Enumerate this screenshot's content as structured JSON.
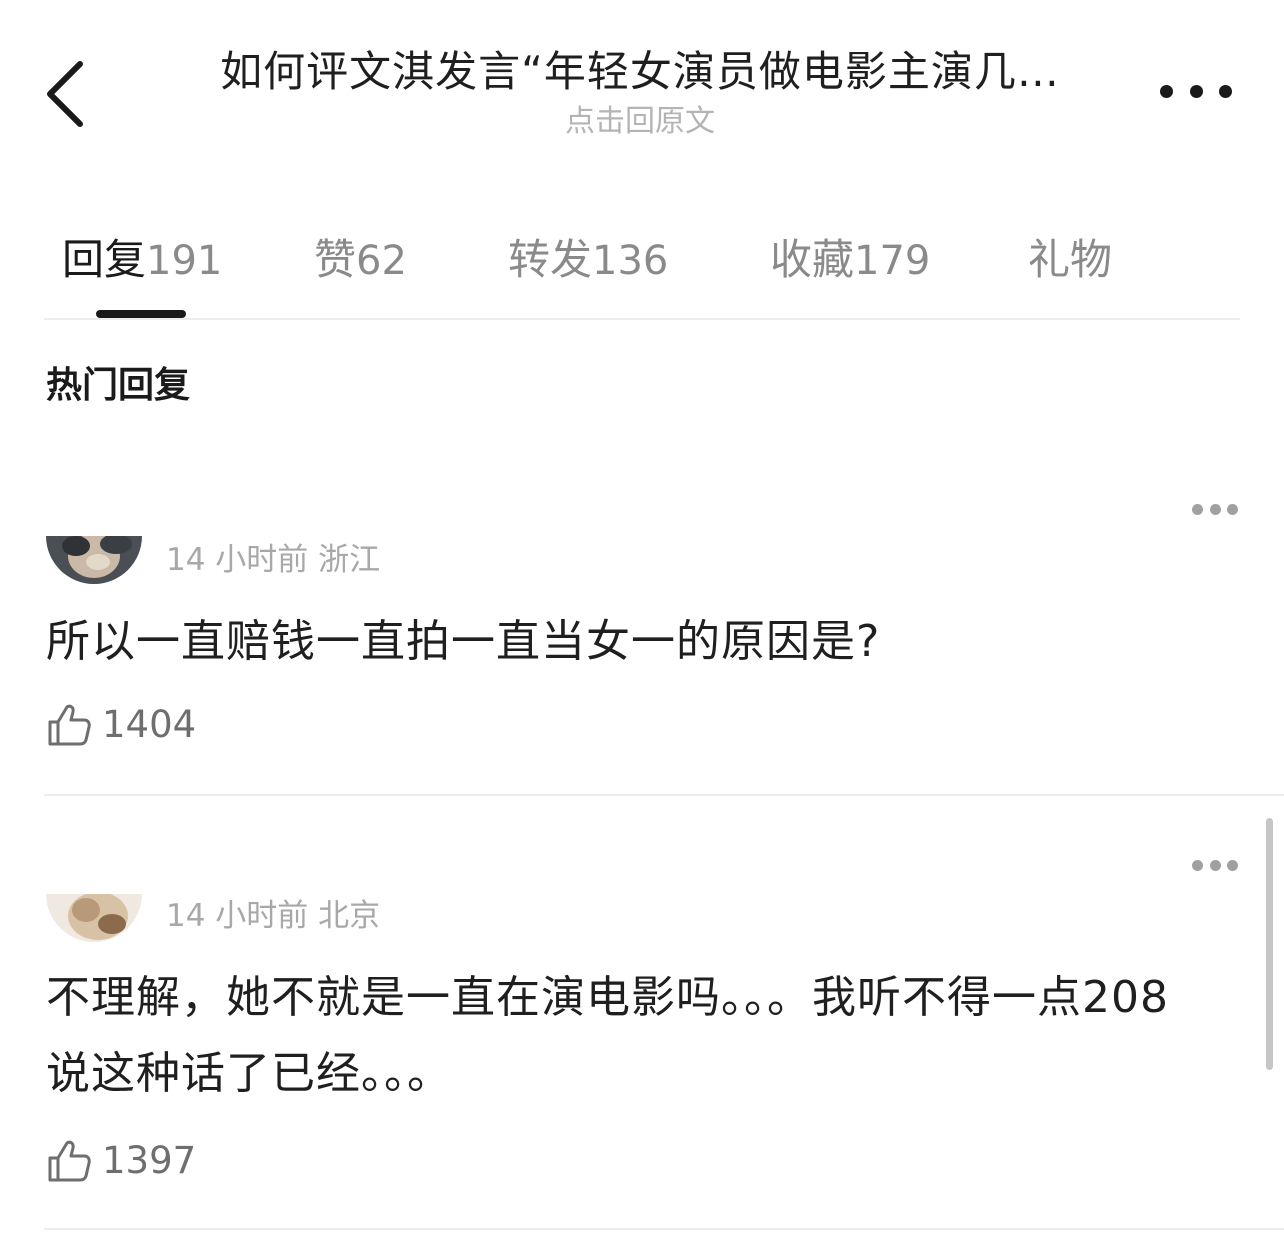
{
  "header": {
    "title": "如何评文淇发言“年轻女演员做电影主演几…",
    "subtitle": "点击回原文"
  },
  "tabs": [
    {
      "label": "回复",
      "count": "191",
      "active": true
    },
    {
      "label": "赞",
      "count": "62",
      "active": false
    },
    {
      "label": "转发",
      "count": "136",
      "active": false
    },
    {
      "label": "收藏",
      "count": "179",
      "active": false
    },
    {
      "label": "礼物",
      "count": "",
      "active": false
    }
  ],
  "section_title": "热门回复",
  "comments": [
    {
      "time": "14 小时前",
      "location": "浙江",
      "text": "所以一直赔钱一直拍一直当女一的原因是?",
      "likes": "1404"
    },
    {
      "time": "14 小时前",
      "location": "北京",
      "text": "不理解，她不就是一直在演电影吗。。。我听不得一点208说这种话了已经。。。",
      "likes": "1397"
    }
  ],
  "icons": {
    "back": "chevron-left-icon",
    "more": "more-dots-icon",
    "like": "thumbs-up-icon"
  },
  "colors": {
    "text_primary": "#1a1a1a",
    "text_secondary": "#8a8a8a",
    "meta": "#a8a8a8",
    "divider": "#ededed"
  }
}
